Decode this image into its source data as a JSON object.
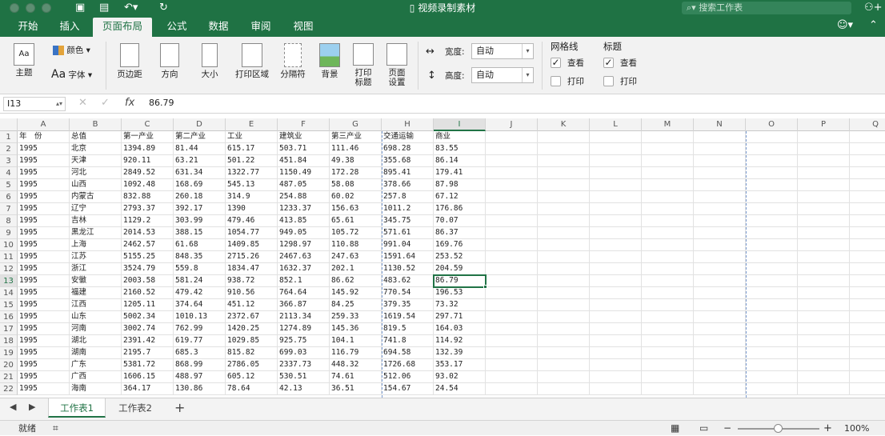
{
  "app": {
    "title": "视频录制素材",
    "search_placeholder": "搜索工作表"
  },
  "colors": {
    "accent": "#217346",
    "titlebar": "#1f7244"
  },
  "tabs": [
    {
      "label": "开始",
      "active": false
    },
    {
      "label": "插入",
      "active": false
    },
    {
      "label": "页面布局",
      "active": true
    },
    {
      "label": "公式",
      "active": false
    },
    {
      "label": "数据",
      "active": false
    },
    {
      "label": "审阅",
      "active": false
    },
    {
      "label": "视图",
      "active": false
    }
  ],
  "ribbon": {
    "theme": "主题",
    "colors": "颜色",
    "fonts": "字体",
    "fonts_glyph": "Aa",
    "margins": "页边距",
    "orientation": "方向",
    "size": "大小",
    "print_area": "打印区域",
    "breaks": "分隔符",
    "background": "背景",
    "print_titles_1": "打印",
    "print_titles_2": "标题",
    "page_setup_1": "页面",
    "page_setup_2": "设置",
    "width_label": "宽度:",
    "width_value": "自动",
    "height_label": "高度:",
    "height_value": "自动",
    "gridlines": "网格线",
    "headings": "标题",
    "view": "查看",
    "print": "打印"
  },
  "formula_bar": {
    "cell_ref": "I13",
    "fx": "fx",
    "value": "86.79"
  },
  "sheet": {
    "columns": [
      "A",
      "B",
      "C",
      "D",
      "E",
      "F",
      "G",
      "H",
      "I",
      "J",
      "K",
      "L",
      "M",
      "N",
      "O",
      "P",
      "Q"
    ],
    "rows": [
      [
        "年　份",
        "总值",
        "第一产业",
        "第二产业",
        "工业",
        "建筑业",
        "第三产业",
        "交通运输",
        "商业"
      ],
      [
        "1995",
        "北京",
        "1394.89",
        "81.44",
        "615.17",
        "503.71",
        "111.46",
        "698.28",
        "83.55"
      ],
      [
        "1995",
        "天津",
        "920.11",
        "63.21",
        "501.22",
        "451.84",
        "49.38",
        "355.68",
        "86.14"
      ],
      [
        "1995",
        "河北",
        "2849.52",
        "631.34",
        "1322.77",
        "1150.49",
        "172.28",
        "895.41",
        "179.41"
      ],
      [
        "1995",
        "山西",
        "1092.48",
        "168.69",
        "545.13",
        "487.05",
        "58.08",
        "378.66",
        "87.98"
      ],
      [
        "1995",
        "内蒙古",
        "832.88",
        "260.18",
        "314.9",
        "254.88",
        "60.02",
        "257.8",
        "67.12"
      ],
      [
        "1995",
        "辽宁",
        "2793.37",
        "392.17",
        "1390",
        "1233.37",
        "156.63",
        "1011.2",
        "176.86"
      ],
      [
        "1995",
        "吉林",
        "1129.2",
        "303.99",
        "479.46",
        "413.85",
        "65.61",
        "345.75",
        "70.07"
      ],
      [
        "1995",
        "黑龙江",
        "2014.53",
        "388.15",
        "1054.77",
        "949.05",
        "105.72",
        "571.61",
        "86.37"
      ],
      [
        "1995",
        "上海",
        "2462.57",
        "61.68",
        "1409.85",
        "1298.97",
        "110.88",
        "991.04",
        "169.76"
      ],
      [
        "1995",
        "江苏",
        "5155.25",
        "848.35",
        "2715.26",
        "2467.63",
        "247.63",
        "1591.64",
        "253.52"
      ],
      [
        "1995",
        "浙江",
        "3524.79",
        "559.8",
        "1834.47",
        "1632.37",
        "202.1",
        "1130.52",
        "204.59"
      ],
      [
        "1995",
        "安徽",
        "2003.58",
        "581.24",
        "938.72",
        "852.1",
        "86.62",
        "483.62",
        "86.79"
      ],
      [
        "1995",
        "福建",
        "2160.52",
        "479.42",
        "910.56",
        "764.64",
        "145.92",
        "770.54",
        "196.53"
      ],
      [
        "1995",
        "江西",
        "1205.11",
        "374.64",
        "451.12",
        "366.87",
        "84.25",
        "379.35",
        "73.32"
      ],
      [
        "1995",
        "山东",
        "5002.34",
        "1010.13",
        "2372.67",
        "2113.34",
        "259.33",
        "1619.54",
        "297.71"
      ],
      [
        "1995",
        "河南",
        "3002.74",
        "762.99",
        "1420.25",
        "1274.89",
        "145.36",
        "819.5",
        "164.03"
      ],
      [
        "1995",
        "湖北",
        "2391.42",
        "619.77",
        "1029.85",
        "925.75",
        "104.1",
        "741.8",
        "114.92"
      ],
      [
        "1995",
        "湖南",
        "2195.7",
        "685.3",
        "815.82",
        "699.03",
        "116.79",
        "694.58",
        "132.39"
      ],
      [
        "1995",
        "广东",
        "5381.72",
        "868.99",
        "2786.05",
        "2337.73",
        "448.32",
        "1726.68",
        "353.17"
      ],
      [
        "1995",
        "广西",
        "1606.15",
        "488.97",
        "605.12",
        "530.51",
        "74.61",
        "512.06",
        "93.02"
      ],
      [
        "1995",
        "海南",
        "364.17",
        "130.86",
        "78.64",
        "42.13",
        "36.51",
        "154.67",
        "24.54"
      ]
    ]
  },
  "sheet_tabs": [
    {
      "label": "工作表1",
      "active": true
    },
    {
      "label": "工作表2",
      "active": false
    }
  ],
  "status": {
    "ready": "就绪",
    "zoom": "100%",
    "zoom_fraction": 0.5
  }
}
